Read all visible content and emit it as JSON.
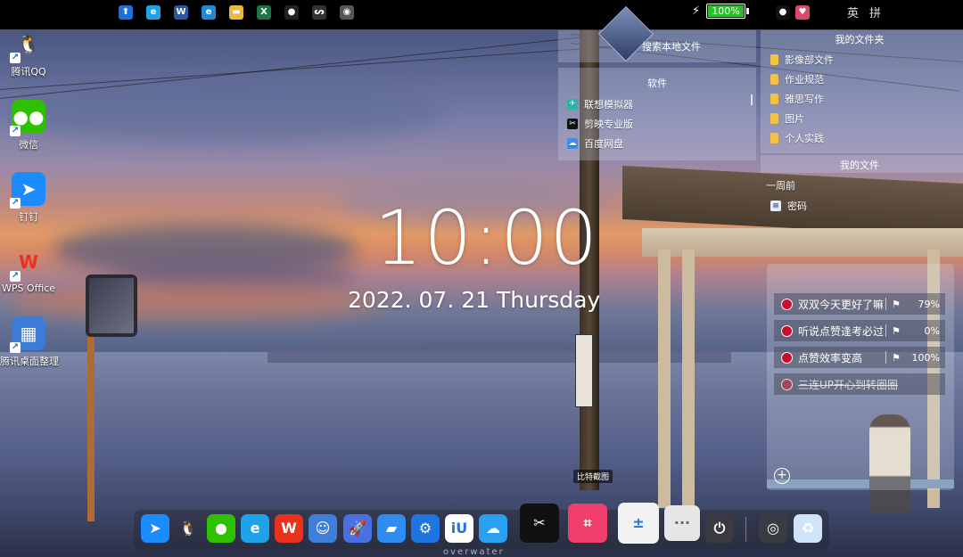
{
  "taskbar": {
    "apps": [
      {
        "name": "security-app-icon",
        "glyph": "⬆",
        "color": "#1f6fd8"
      },
      {
        "name": "browser-360-icon",
        "glyph": "e",
        "color": "#1fa2e8"
      },
      {
        "name": "word-icon",
        "glyph": "W",
        "color": "#2b579a"
      },
      {
        "name": "edge-icon",
        "glyph": "e",
        "color": "#1f8ad8"
      },
      {
        "name": "file-explorer-icon",
        "glyph": "▬",
        "color": "#e8b93a"
      },
      {
        "name": "excel-icon",
        "glyph": "X",
        "color": "#217346"
      },
      {
        "name": "qq-tray-icon",
        "glyph": "●",
        "color": "#222"
      },
      {
        "name": "swirl-app-icon",
        "glyph": "ᔕ",
        "color": "#333"
      },
      {
        "name": "disc-app-icon",
        "glyph": "◉",
        "color": "#555"
      }
    ],
    "battery": {
      "percent_label": "100%",
      "level": 1.0,
      "fill_color": "#27c02a"
    },
    "ime_label": "英",
    "ime_grid": "拼"
  },
  "desktop_icons": [
    {
      "label": "腾讯QQ",
      "glyph": "🐧",
      "color": "transparent"
    },
    {
      "label": "微信",
      "glyph": "●●",
      "color": "#2dc100"
    },
    {
      "label": "钉钉",
      "glyph": "➤",
      "color": "#1a8cff"
    },
    {
      "label": "WPS Office",
      "glyph": "W",
      "color": "transparent"
    },
    {
      "label": "腾讯桌面整理",
      "glyph": "▦",
      "color": "#3d7bd9"
    }
  ],
  "clock": {
    "time": "10:00",
    "date": "2022. 07. 21  Thursday"
  },
  "fences": {
    "search_label": "搜索本地文件",
    "software": {
      "title": "软件",
      "items": [
        {
          "label": "联想模拟器",
          "color": "#2bb3a4",
          "glyph": "✈"
        },
        {
          "label": "剪映专业版",
          "color": "#111",
          "glyph": "✂"
        },
        {
          "label": "百度网盘",
          "color": "#3b8ef0",
          "glyph": "☁"
        }
      ]
    },
    "my_folders": {
      "title": "我的文件夹",
      "items": [
        "影像部文件",
        "作业规范",
        "雅思写作",
        "图片",
        "个人实践"
      ]
    },
    "my_files": {
      "title": "我的文件",
      "group_label": "一周前",
      "items": [
        {
          "label": "密码"
        }
      ]
    }
  },
  "todo": {
    "items": [
      {
        "text": "双双今天更好了嘛",
        "progress": "79%",
        "done": false
      },
      {
        "text": "听说点赞逢考必过",
        "progress": "0%",
        "done": false
      },
      {
        "text": "点赞效率变高",
        "progress": "100%",
        "done": false
      },
      {
        "text": "三连UP开心到转圈圈",
        "progress": "",
        "done": true
      }
    ],
    "add_label": "+"
  },
  "dock": {
    "tooltip": "比特截图",
    "apps": [
      {
        "name": "dingtalk-icon",
        "glyph": "➤",
        "color": "#1a8cff"
      },
      {
        "name": "qq-icon",
        "glyph": "🐧",
        "color": "transparent"
      },
      {
        "name": "wechat-icon",
        "glyph": "●",
        "color": "#2dc100"
      },
      {
        "name": "browser-360-icon",
        "glyph": "e",
        "color": "#1fa2e8"
      },
      {
        "name": "wps-icon",
        "glyph": "W",
        "color": "#e8321e"
      },
      {
        "name": "finder-icon",
        "glyph": "☺",
        "color": "#3f7fd8"
      },
      {
        "name": "rocket-icon",
        "glyph": "🚀",
        "color": "#4a6fe0"
      },
      {
        "name": "store-icon",
        "glyph": "▰",
        "color": "#2f8cf0"
      },
      {
        "name": "settings-icon",
        "glyph": "⚙",
        "color": "#1e74e0"
      },
      {
        "name": "iu-icon",
        "glyph": "iU",
        "color": "#fff"
      },
      {
        "name": "baidu-netdisk-icon",
        "glyph": "☁",
        "color": "#2aa0f0"
      },
      {
        "name": "capcut-icon",
        "glyph": "✂",
        "color": "#111"
      },
      {
        "name": "screenshot-icon",
        "glyph": "⌗",
        "color": "#f03e6a"
      },
      {
        "name": "calculator-icon",
        "glyph": "±",
        "color": "#f2f2f2"
      },
      {
        "name": "more-icon",
        "glyph": "···",
        "color": "#e6e6e6"
      },
      {
        "name": "power-icon",
        "glyph": "⏻",
        "color": "#3a3a40"
      },
      {
        "name": "steam-icon",
        "glyph": "◎",
        "color": "#3a3c44"
      },
      {
        "name": "recycle-bin-icon",
        "glyph": "♻",
        "color": "#cfe4f6"
      }
    ]
  },
  "watermark": "overwater"
}
